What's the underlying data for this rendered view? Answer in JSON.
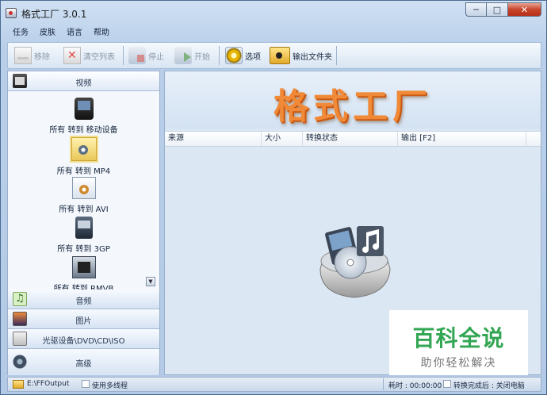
{
  "window": {
    "title": "格式工厂 3.0.1",
    "minimize": "─",
    "maximize": "□",
    "close": "✕"
  },
  "menu": [
    "任务",
    "皮肤",
    "语言",
    "帮助"
  ],
  "toolbar": {
    "remove": "移除",
    "clear_list": "清空列表",
    "stop": "停止",
    "start": "开始",
    "options": "选项",
    "output_folder": "输出文件夹"
  },
  "sidebar": {
    "categories": {
      "video": "视频",
      "audio": "音频",
      "image": "图片",
      "rom": "光驱设备\\DVD\\CD\\ISO",
      "advanced": "高级"
    },
    "video_items": [
      {
        "label": "所有 转到 移动设备",
        "icon": "mobile-device-icon"
      },
      {
        "label": "所有 转到 MP4",
        "icon": "mp4-icon"
      },
      {
        "label": "所有 转到 AVI",
        "icon": "avi-icon"
      },
      {
        "label": "所有 转到 3GP",
        "icon": "3gp-icon"
      },
      {
        "label": "所有 转到 RMVB",
        "icon": "rmvb-icon"
      }
    ]
  },
  "main": {
    "banner_title": "格式工厂",
    "columns": [
      "来源",
      "大小",
      "转换状态",
      "输出 [F2]"
    ]
  },
  "watermark": {
    "main": "百科全说",
    "sub": "助你轻松解决"
  },
  "status": {
    "output_path": "E:\\FFOutput",
    "multithread": "使用多线程",
    "elapsed": "耗时 : 00:00:00",
    "after_convert": "转换完成后 : 关闭电脑"
  },
  "colors": {
    "banner_text": "#f08a38",
    "watermark_green": "#33a654",
    "window_frame": "#4c6a92"
  }
}
